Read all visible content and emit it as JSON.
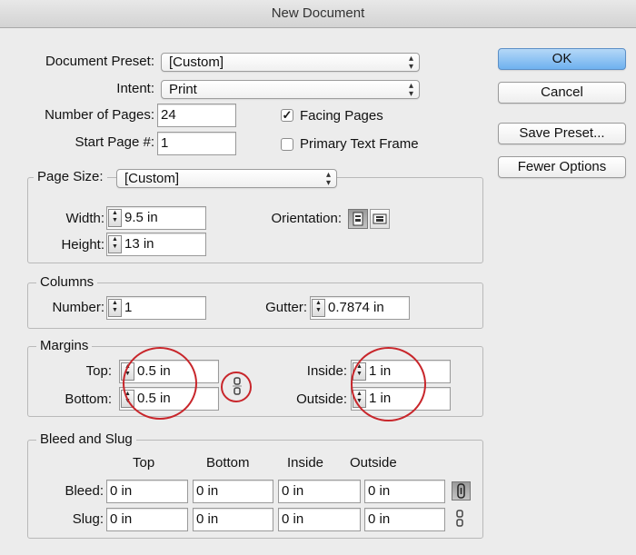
{
  "window": {
    "title": "New Document"
  },
  "form": {
    "document_preset": {
      "label": "Document Preset:",
      "value": "[Custom]"
    },
    "intent": {
      "label": "Intent:",
      "value": "Print"
    },
    "number_of_pages": {
      "label": "Number of Pages:",
      "value": "24"
    },
    "start_page": {
      "label": "Start Page #:",
      "value": "1"
    },
    "facing_pages": {
      "label": "Facing Pages",
      "checked": true
    },
    "primary_text_frame": {
      "label": "Primary Text Frame",
      "checked": false
    }
  },
  "buttons": {
    "ok": "OK",
    "cancel": "Cancel",
    "save_preset": "Save Preset...",
    "fewer_options": "Fewer Options"
  },
  "page_size": {
    "legend": "Page Size:",
    "value": "[Custom]",
    "width_label": "Width:",
    "width": "9.5 in",
    "height_label": "Height:",
    "height": "13 in",
    "orientation_label": "Orientation:",
    "orientation_selected": "portrait"
  },
  "columns": {
    "legend": "Columns",
    "number_label": "Number:",
    "number": "1",
    "gutter_label": "Gutter:",
    "gutter": "0.7874 in"
  },
  "margins": {
    "legend": "Margins",
    "top_label": "Top:",
    "top": "0.5 in",
    "bottom_label": "Bottom:",
    "bottom": "0.5 in",
    "inside_label": "Inside:",
    "inside": "1 in",
    "outside_label": "Outside:",
    "outside": "1 in",
    "link_state": "unlinked"
  },
  "bleed_slug": {
    "legend": "Bleed and Slug",
    "headers": [
      "Top",
      "Bottom",
      "Inside",
      "Outside"
    ],
    "bleed_label": "Bleed:",
    "bleed": [
      "0 in",
      "0 in",
      "0 in",
      "0 in"
    ],
    "slug_label": "Slug:",
    "slug": [
      "0 in",
      "0 in",
      "0 in",
      "0 in"
    ],
    "bleed_link_state": "linked",
    "slug_link_state": "unlinked"
  },
  "annotations": {
    "color": "#c8262b"
  }
}
